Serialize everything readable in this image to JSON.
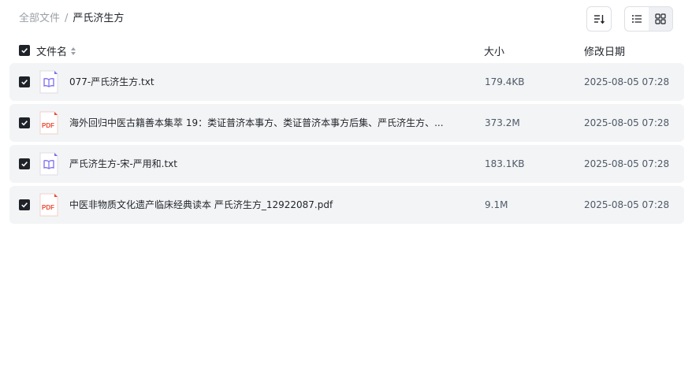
{
  "breadcrumb": {
    "root": "全部文件",
    "separator": "/",
    "current": "严氏济生方"
  },
  "toolbar": {
    "sort_icon": "sort-list-icon",
    "views": [
      {
        "icon": "list-view-icon",
        "active": false
      },
      {
        "icon": "grid-view-icon",
        "active": true
      }
    ]
  },
  "table": {
    "headers": {
      "name": "文件名",
      "size": "大小",
      "date": "修改日期"
    },
    "rows": [
      {
        "name": "077-严氏济生方.txt",
        "size": "179.4KB",
        "date": "2025-08-05 07:28",
        "type": "txt",
        "checked": true
      },
      {
        "name": "海外回归中医古籍善本集萃 19：类证普济本事方、类证普济本事方后集、严氏济生方、...",
        "size": "373.2M",
        "date": "2025-08-05 07:28",
        "type": "pdf",
        "checked": true
      },
      {
        "name": "严氏济生方-宋-严用和.txt",
        "size": "183.1KB",
        "date": "2025-08-05 07:28",
        "type": "txt",
        "checked": true
      },
      {
        "name": "中医非物质文化遗产临床经典读本 严氏济生方_12922087.pdf",
        "size": "9.1M",
        "date": "2025-08-05 07:28",
        "type": "pdf",
        "checked": true
      }
    ]
  },
  "icons": {
    "txt": "book-file-icon",
    "pdf": "pdf-file-icon",
    "pdf_label": "PDF"
  },
  "colors": {
    "checkbox": "#1f2329",
    "row_bg": "#f3f4f5",
    "pdf_red": "#e94b35",
    "txt_purple": "#7b6cf0",
    "muted": "#9aa0a6"
  }
}
